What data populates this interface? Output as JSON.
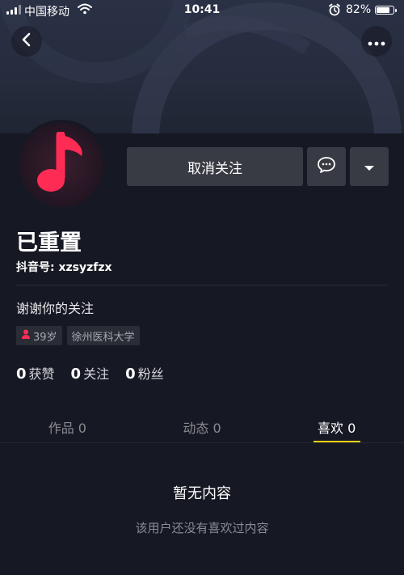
{
  "status_bar": {
    "carrier": "中国移动",
    "time": "10:41",
    "battery": "82%",
    "battery_level": 0.82
  },
  "profile": {
    "nickname": "已重置",
    "douyin_id": "抖音号: xzsyzfzx",
    "signature": "谢谢你的关注",
    "tags": [
      {
        "icon": "female-icon",
        "text": "39岁"
      },
      {
        "text": "徐州医科大学"
      }
    ],
    "stats": [
      {
        "num": "0",
        "label": "获赞"
      },
      {
        "num": "0",
        "label": "关注"
      },
      {
        "num": "0",
        "label": "粉丝"
      }
    ]
  },
  "actions": {
    "unfollow_label": "取消关注"
  },
  "tabs": [
    {
      "label": "作品 0",
      "active": false
    },
    {
      "label": "动态 0",
      "active": false
    },
    {
      "label": "喜欢 0",
      "active": true
    }
  ],
  "empty_state": {
    "title": "暂无内容",
    "subtitle": "该用户还没有喜欢过内容"
  },
  "colors": {
    "background": "#161823",
    "accent_yellow": "#face15",
    "avatar_note": "#fe2c55",
    "button_bg": "#393b44"
  }
}
